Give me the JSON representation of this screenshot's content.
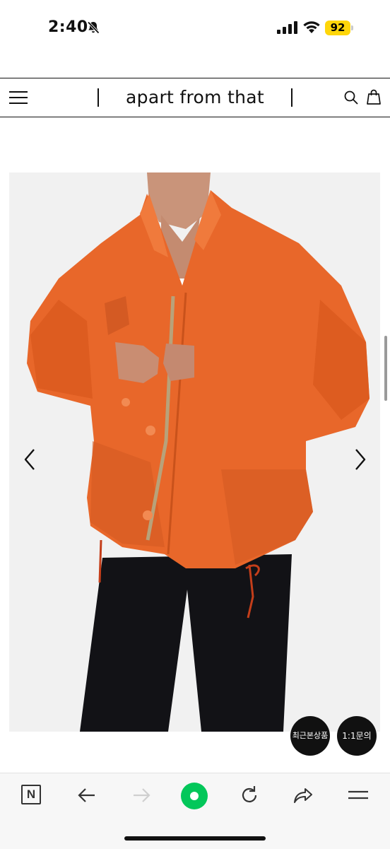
{
  "status_bar": {
    "time": "2:40",
    "battery": "92",
    "colors": {
      "battery": "#ffd60a"
    }
  },
  "header": {
    "brand": "apart from that"
  },
  "product": {
    "image_alt": "orange jacket"
  },
  "floating_buttons": {
    "recent": "최근본상품",
    "inquiry": "1:1문의"
  },
  "browser_bar": {
    "n_label": "N",
    "accent": "#03c75a"
  },
  "icons": [
    "bell-slash-icon",
    "signal-icon",
    "wifi-icon",
    "battery-icon",
    "menu-icon",
    "search-icon",
    "bag-icon",
    "chevron-left-icon",
    "chevron-right-icon",
    "back-arrow-icon",
    "forward-arrow-icon",
    "green-dot-icon",
    "reload-icon",
    "share-icon",
    "hamburger-icon"
  ]
}
